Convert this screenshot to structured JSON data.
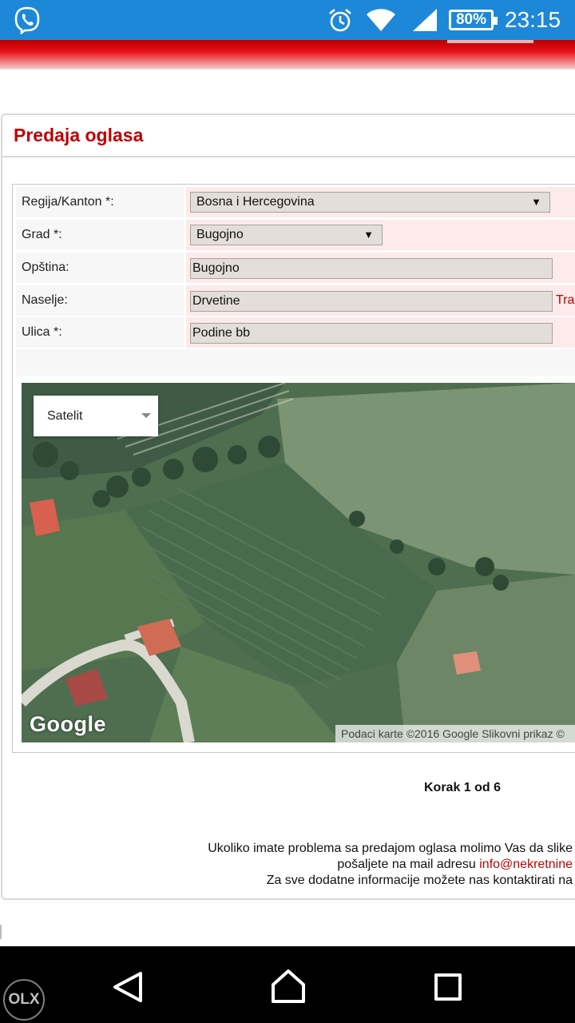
{
  "status_bar": {
    "time": "23:15",
    "battery": "80%",
    "icons": [
      "viber-icon",
      "alarm-icon",
      "wifi-icon",
      "signal-icon",
      "battery-icon"
    ]
  },
  "page": {
    "title": "Predaja oglasa"
  },
  "form": {
    "region": {
      "label": "Regija/Kanton *:",
      "value": "Bosna i Hercegovina"
    },
    "city": {
      "label": "Grad *:",
      "value": "Bugojno"
    },
    "municipality": {
      "label": "Opština:",
      "value": "Bugojno"
    },
    "settlement": {
      "label": "Naselje:",
      "value": "Drvetine",
      "side_link": "Tra"
    },
    "street": {
      "label": "Ulica *:",
      "value": "Podine bb"
    }
  },
  "map": {
    "type_selector": "Satelit",
    "logo": "Google",
    "attribution": "Podaci karte ©2016 Google Slikovni prikaz ©"
  },
  "step": "Korak 1 od 6",
  "footer": {
    "line1": "Ukoliko imate problema sa predajom oglasa molimo Vas da slike",
    "line2_prefix": "pošaljete na mail adresu ",
    "line2_email": "info@nekretnine",
    "line3": "Za sve dodatne informacije možete nas kontaktirati na"
  },
  "nav": {
    "watermark": "OLX"
  },
  "colors": {
    "status_bar": "#1e88d8",
    "brand_red": "#c00000",
    "field_bg": "#fdeaea",
    "input_bg": "#e3ded8",
    "nav_bar": "#000000"
  }
}
